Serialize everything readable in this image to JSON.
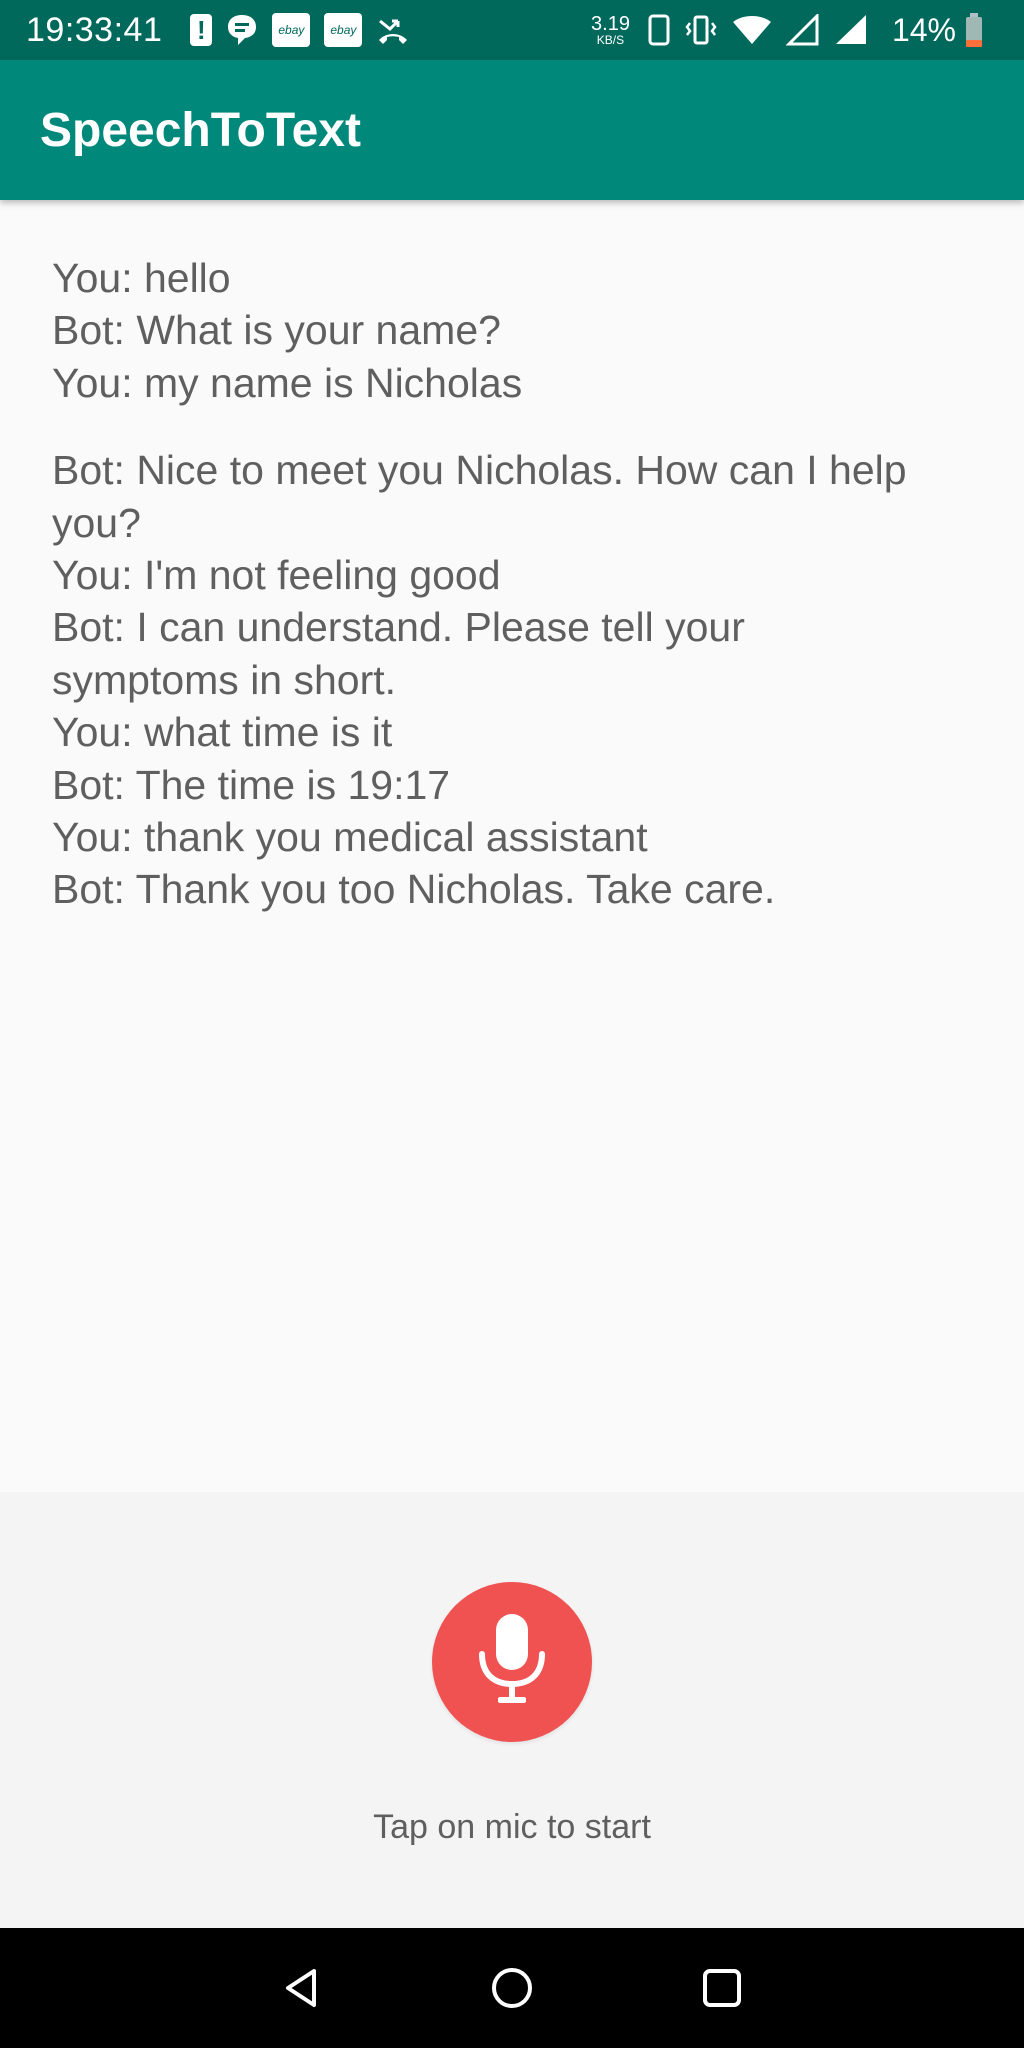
{
  "status_bar": {
    "time": "19:33:41",
    "net_speed_value": "3.19",
    "net_speed_unit": "KB/S",
    "battery_percent": "14%",
    "ebay_label_1": "ebay",
    "ebay_label_2": "ebay",
    "alert_glyph": "!",
    "icons": [
      "alert-icon",
      "message-icon",
      "ebay-icon",
      "ebay-icon",
      "missed-call-icon",
      "phone-outline-icon",
      "vibrate-icon",
      "wifi-icon",
      "signal-icon",
      "signal-icon",
      "battery-low-icon"
    ]
  },
  "app_bar": {
    "title": "SpeechToText",
    "color": "#00897b"
  },
  "conversation": {
    "lines": [
      "You: hello",
      "Bot: What is your name?",
      "You: my name is Nicholas",
      "",
      "Bot: Nice to meet you Nicholas. How can I help",
      "you?",
      "You: I'm not feeling good",
      "Bot: I can understand. Please tell your",
      "symptoms in short.",
      "You: what time is it",
      "Bot: The time is 19:17",
      "You: thank you medical assistant",
      "Bot: Thank you too Nicholas. Take care."
    ]
  },
  "mic": {
    "icon": "microphone-icon",
    "color": "#f05252",
    "hint": "Tap on mic to start"
  },
  "nav_bar": {
    "icons": [
      "back-icon",
      "home-icon",
      "recents-icon"
    ]
  }
}
